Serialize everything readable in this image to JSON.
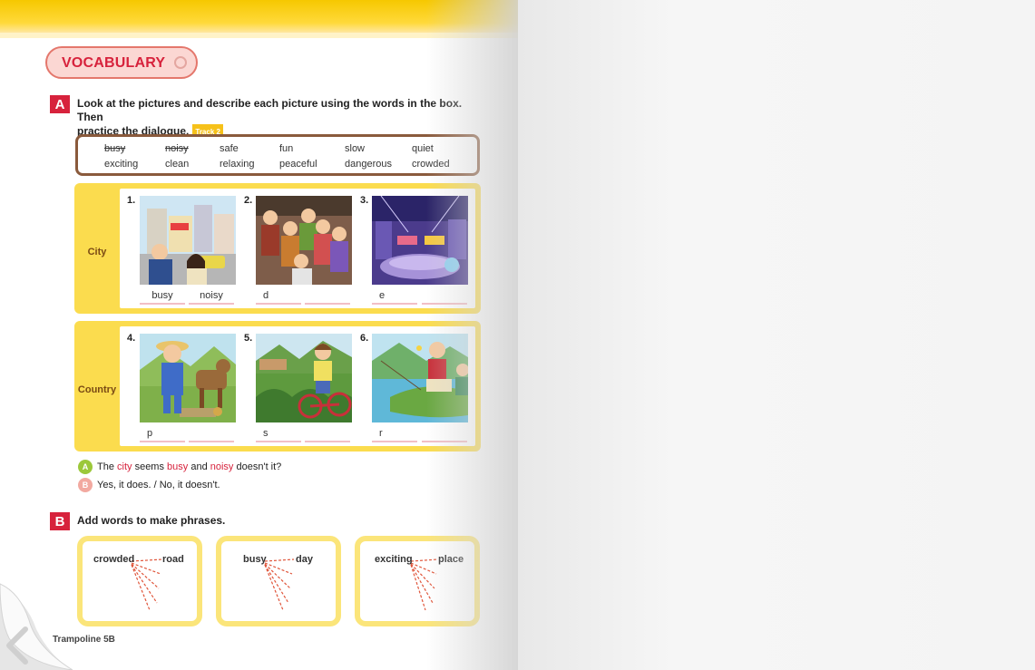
{
  "header": {
    "title": "VOCABULARY"
  },
  "sectionA": {
    "badge": "A",
    "instruction_line1": "Look at the pictures and describe each picture using the words in the box. Then",
    "instruction_line2": "practice the dialogue.",
    "track": "Track 2",
    "word_box": [
      [
        "busy",
        "noisy",
        "safe",
        "fun",
        "slow",
        "quiet"
      ],
      [
        "exciting",
        "clean",
        "relaxing",
        "peaceful",
        "dangerous",
        "crowded"
      ]
    ],
    "city": {
      "label": "City",
      "pictures": [
        {
          "num": "1.",
          "blanks": [
            "busy",
            "noisy"
          ]
        },
        {
          "num": "2.",
          "blanks": [
            "d",
            ""
          ]
        },
        {
          "num": "3.",
          "blanks": [
            "e",
            ""
          ]
        }
      ]
    },
    "country": {
      "label": "Country",
      "pictures": [
        {
          "num": "4.",
          "blanks": [
            "p",
            ""
          ]
        },
        {
          "num": "5.",
          "blanks": [
            "s",
            ""
          ]
        },
        {
          "num": "6.",
          "blanks": [
            "r",
            ""
          ]
        }
      ]
    },
    "dialogue": {
      "a_icon": "A",
      "a_p1": "The ",
      "a_city": "city",
      "a_p2": " seems ",
      "a_busy": "busy",
      "a_p3": " and ",
      "a_noisy": "noisy",
      "a_p4": " doesn't it?",
      "b_icon": "B",
      "b_line": "Yes, it does. / No, it doesn't."
    }
  },
  "sectionB": {
    "badge": "B",
    "instruction": "Add words to make phrases.",
    "cards": [
      {
        "word1": "crowded",
        "word2": "road"
      },
      {
        "word1": "busy",
        "word2": "day"
      },
      {
        "word1": "exciting",
        "word2": "place"
      }
    ]
  },
  "footer": {
    "text": "Trampoline 5B"
  },
  "colors": {
    "accent_red": "#d7223c",
    "panel_yellow": "#fbdc4e",
    "box_brown": "#8a5a3c"
  }
}
